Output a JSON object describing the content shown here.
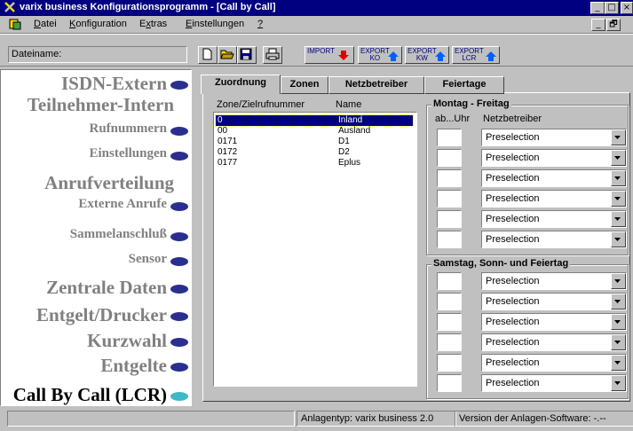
{
  "window": {
    "title": "varix business Konfigurationsprogramm - [Call by Call]",
    "min_glyph": "_",
    "max_glyph": "□",
    "close_glyph": "×"
  },
  "menu": {
    "items": [
      {
        "label": "Datei",
        "accel": "D"
      },
      {
        "label": "Konfiguration",
        "accel": "K"
      },
      {
        "label": "Extras",
        "accel": "x"
      },
      {
        "label": "Einstellungen",
        "accel": "E"
      },
      {
        "label": "?",
        "accel": "?"
      }
    ],
    "child_min": "_",
    "child_restore": "🗗"
  },
  "toolbar": {
    "filename_label": "Dateiname:",
    "import_label": "IMPORT",
    "export_ko_label": "EXPORT\nKO",
    "export_kw_label": "EXPORT\nKW",
    "export_lcr_label": "EXPORT\nLCR"
  },
  "nav": {
    "items": [
      {
        "label": "ISDN-Extern",
        "style": "big",
        "oval": true
      },
      {
        "label": "Teilnehmer-Intern",
        "style": "big",
        "oval": false
      },
      {
        "label": "Rufnummern",
        "style": "small",
        "oval": true
      },
      {
        "label": "Einstellungen",
        "style": "small",
        "oval": true
      },
      {
        "label": "Anrufverteilung",
        "style": "big",
        "oval": false
      },
      {
        "label": "Externe Anrufe",
        "style": "small",
        "oval": true
      },
      {
        "label": "Sammelanschluß",
        "style": "small",
        "oval": true
      },
      {
        "label": "Sensor",
        "style": "small",
        "oval": true
      },
      {
        "label": "Zentrale Daten",
        "style": "big",
        "oval": true
      },
      {
        "label": "Entgelt/Drucker",
        "style": "big",
        "oval": true
      },
      {
        "label": "Kurzwahl",
        "style": "big",
        "oval": true
      },
      {
        "label": "Entgelte",
        "style": "big",
        "oval": true
      },
      {
        "label": "Call By Call (LCR)",
        "style": "active",
        "oval": true
      }
    ],
    "oval_color": "#2a2f8f",
    "active_oval_color": "#3fb8c8"
  },
  "tabs": [
    {
      "label": "Zuordnung",
      "active": true
    },
    {
      "label": "Zonen",
      "active": false
    },
    {
      "label": "Netzbetreiber",
      "active": false
    },
    {
      "label": "Feiertage",
      "active": false
    }
  ],
  "zone_list": {
    "col_zone": "Zone/Zielrufnummer",
    "col_name": "Name",
    "rows": [
      {
        "zone": "0",
        "name": "Inland",
        "selected": true
      },
      {
        "zone": "00",
        "name": "Ausland",
        "selected": false
      },
      {
        "zone": "0171",
        "name": "D1",
        "selected": false
      },
      {
        "zone": "0172",
        "name": "D2",
        "selected": false
      },
      {
        "zone": "0177",
        "name": "Eplus",
        "selected": false
      }
    ]
  },
  "weekday_group": {
    "title": "Montag - Freitag",
    "col_time": "ab...Uhr",
    "col_provider": "Netzbetreiber",
    "rows": [
      "Preselection",
      "Preselection",
      "Preselection",
      "Preselection",
      "Preselection",
      "Preselection"
    ]
  },
  "weekend_group": {
    "title": "Samstag, Sonn- und Feiertag",
    "rows": [
      "Preselection",
      "Preselection",
      "Preselection",
      "Preselection",
      "Preselection",
      "Preselection"
    ]
  },
  "status": {
    "panel1": "",
    "panel2": "Anlagentyp: varix business 2.0",
    "panel3": "Version der Anlagen-Software: -.--"
  }
}
